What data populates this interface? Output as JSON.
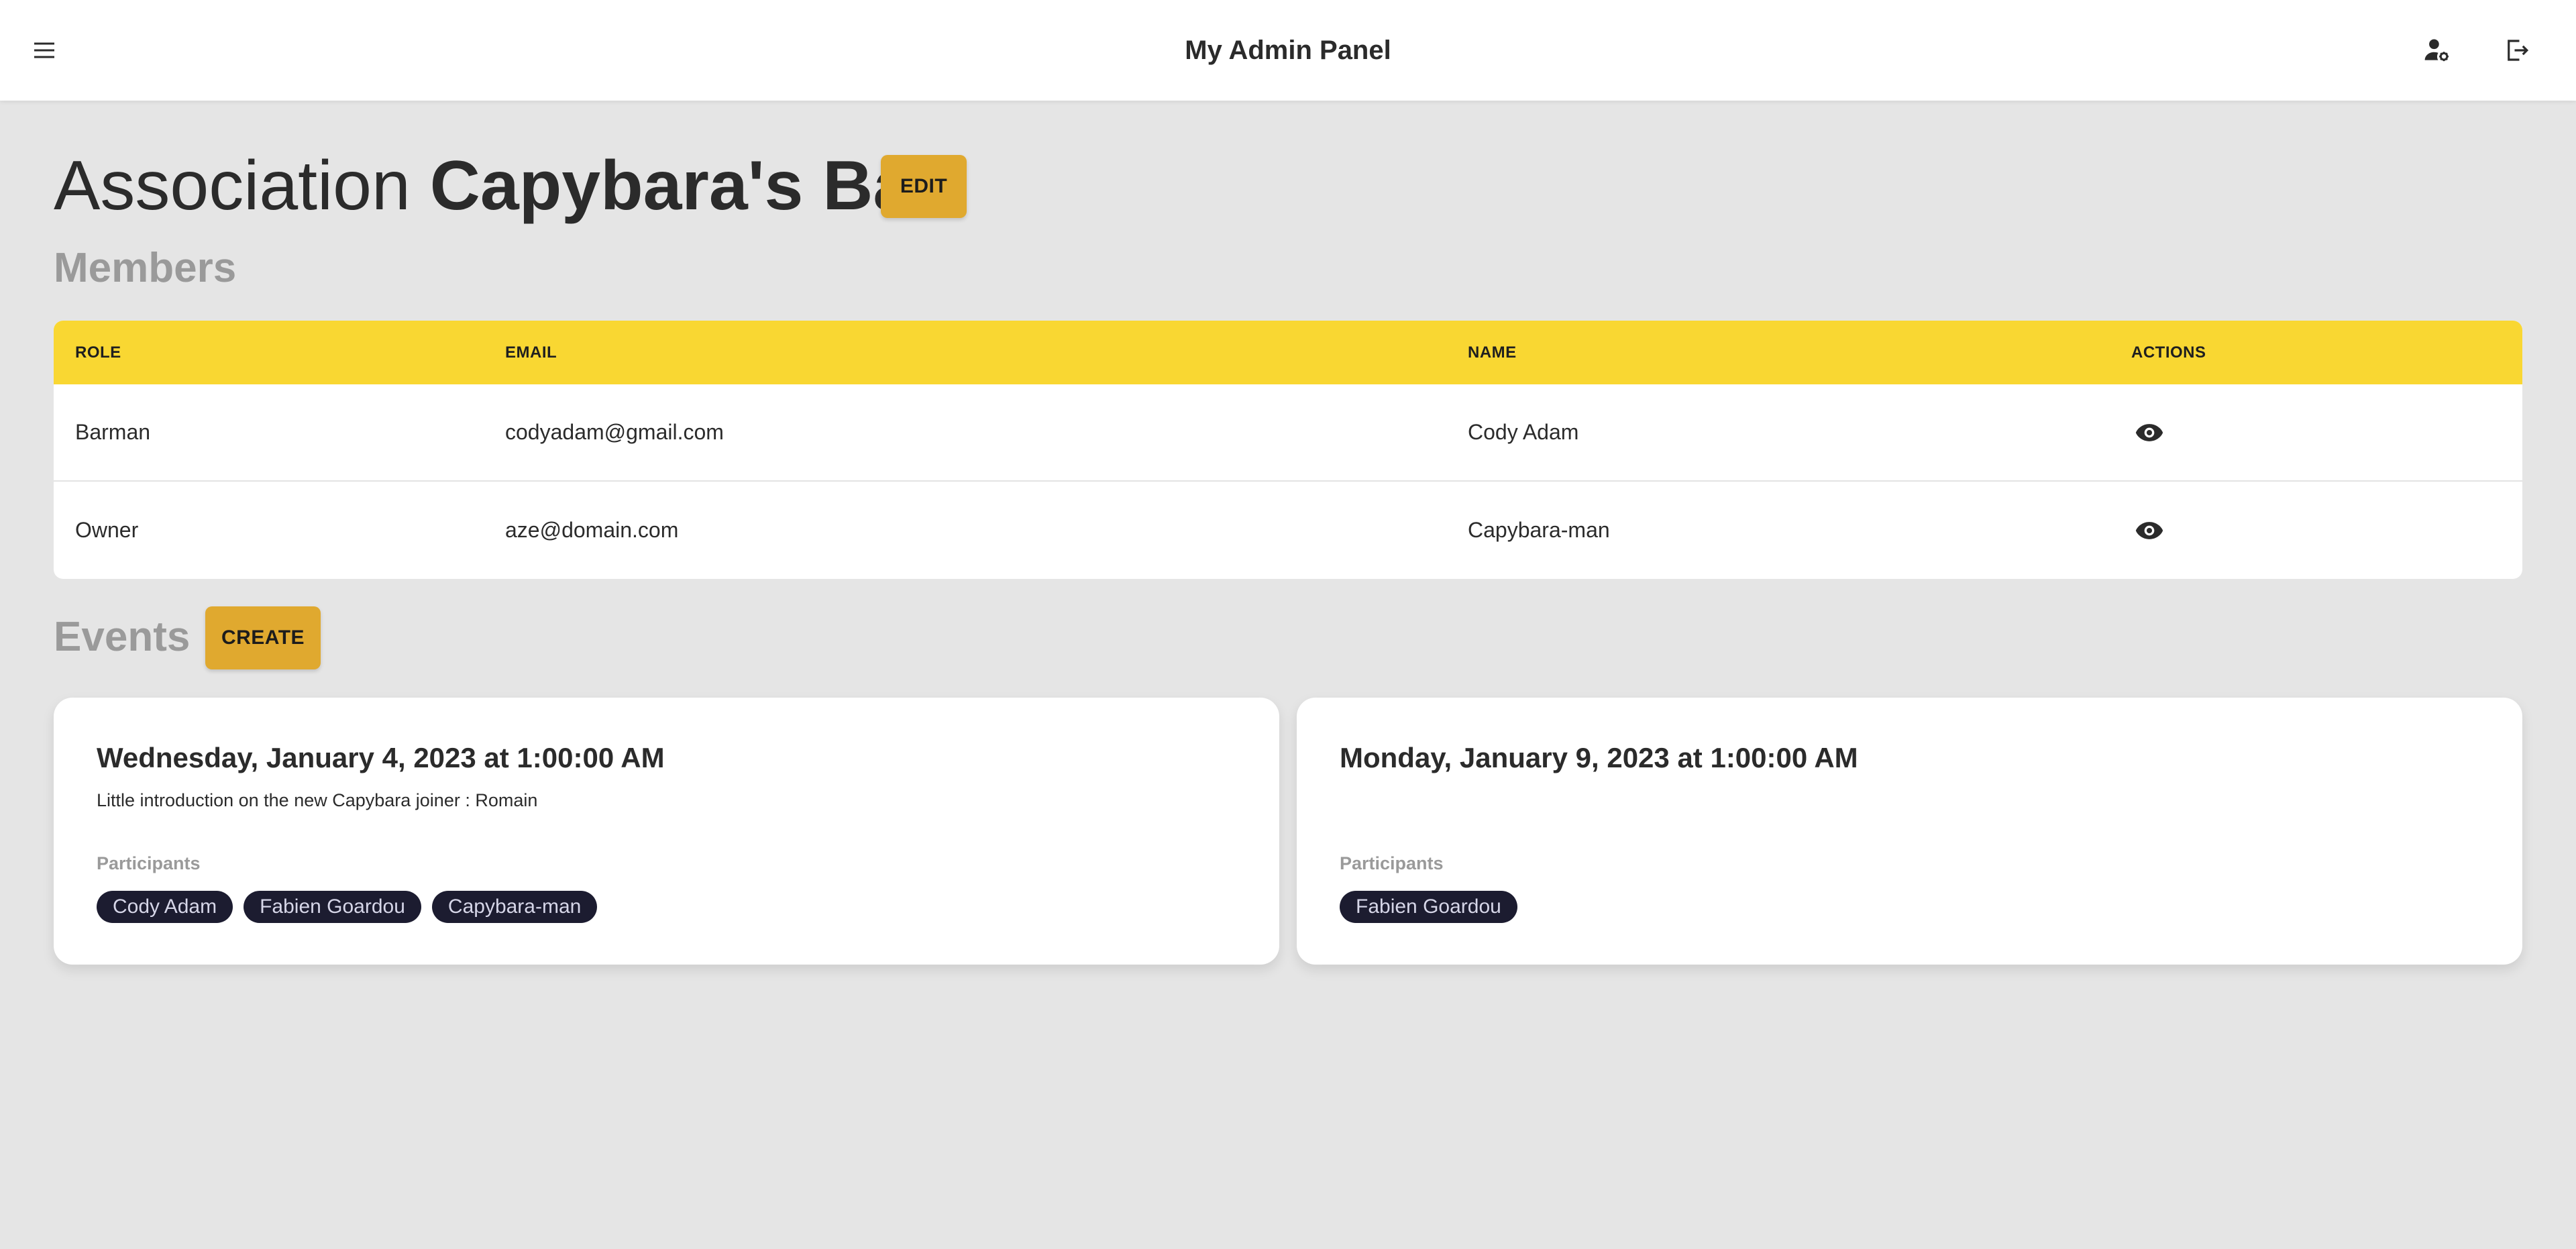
{
  "app": {
    "title": "My Admin Panel",
    "menu_icon": "menu-icon",
    "account_icon": "manage-accounts-icon",
    "logout_icon": "logout-icon"
  },
  "heading": {
    "prefix": "Association",
    "name": "Capybara's Bar",
    "edit_label": "EDIT"
  },
  "members": {
    "title": "Members",
    "columns": {
      "role": "ROLE",
      "email": "EMAIL",
      "name": "NAME",
      "actions": "ACTIONS"
    },
    "rows": [
      {
        "role": "Barman",
        "email": "codyadam@gmail.com",
        "name": "Cody Adam",
        "action_icon": "eye-icon"
      },
      {
        "role": "Owner",
        "email": "aze@domain.com",
        "name": "Capybara-man",
        "action_icon": "eye-icon"
      }
    ]
  },
  "events": {
    "title": "Events",
    "create_label": "CREATE",
    "items": [
      {
        "date": "Wednesday, January 4, 2023 at 1:00:00 AM",
        "description": "Little introduction on the new Capybara joiner : Romain",
        "participants_label": "Participants",
        "participants": [
          "Cody Adam",
          "Fabien Goardou",
          "Capybara-man"
        ]
      },
      {
        "date": "Monday, January 9, 2023 at 1:00:00 AM",
        "description": "",
        "participants_label": "Participants",
        "participants": [
          "Fabien Goardou"
        ]
      }
    ]
  },
  "colors": {
    "page_bg": "#e5e5e5",
    "table_header": "#f9d732",
    "button": "#e0a92f",
    "chip_bg": "#1c1c30"
  }
}
